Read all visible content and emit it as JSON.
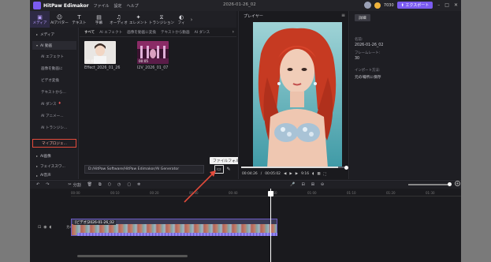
{
  "titlebar": {
    "app_name": "HitPaw Edimakor",
    "menu": [
      "ファイル",
      "設定",
      "ヘルプ"
    ],
    "doc_title": "2026-01-26_02",
    "coins": "7030",
    "export_label": "エクスポート"
  },
  "tools": [
    {
      "label": "メディア",
      "icon": "folder-icon"
    },
    {
      "label": "AIアバター",
      "icon": "avatar-icon"
    },
    {
      "label": "テキスト",
      "icon": "text-icon"
    },
    {
      "label": "字幕",
      "icon": "caption-icon"
    },
    {
      "label": "オーディオ",
      "icon": "music-icon"
    },
    {
      "label": "エレメント",
      "icon": "element-icon"
    },
    {
      "label": "トランジション",
      "icon": "transition-icon"
    },
    {
      "label": "フィ",
      "icon": "filter-icon"
    }
  ],
  "sidebar": {
    "items": [
      "メディア",
      "AI 動画",
      "AI エフェクト",
      "画像を動画に",
      "ビデオ変換",
      "テキストから...",
      "AI ダンス",
      "AI アニメー...",
      "AI トランジシ...",
      "マイプロジェ...",
      "AI画像",
      "フェイススワ...",
      "AI音声"
    ]
  },
  "media": {
    "subtabs": [
      "すべて",
      "AI エフェクト",
      "画像を動画に変換",
      "テキストから動画",
      "AI ダンス"
    ],
    "items": [
      {
        "name": "Effect_2026_01_26",
        "duration": "00:05"
      },
      {
        "name": "I2V_2026_01_07",
        "duration": "00:05"
      }
    ],
    "path": "D:/HitPaw Software/HitPaw Edimakor/AI Generator",
    "tooltip": "ファイルフォルダを開く"
  },
  "player": {
    "title": "プレイヤー",
    "current_time": "00:04:26",
    "total_time": "00:05:02",
    "ratio": "9:16",
    "progress": 0.92
  },
  "details": {
    "tab": "詳細",
    "name_label": "名前:",
    "name_value": "2026-01-26_02",
    "fps_label": "フレームレート:",
    "fps_value": "30",
    "import_label": "インポート方法:",
    "import_value": "元の場所に保存"
  },
  "timeline": {
    "split_label": "分割",
    "ruler": [
      "00:00",
      "00:10",
      "00:20",
      "00:30",
      "00:40",
      "00:50",
      "01:00",
      "01:10",
      "01:20",
      "01:30"
    ],
    "track_label": "カバー",
    "clip_label": "[ビデオ]2026-01-26_02"
  },
  "colors": {
    "accent": "#7b5cf0",
    "highlight": "#e44b3b"
  }
}
